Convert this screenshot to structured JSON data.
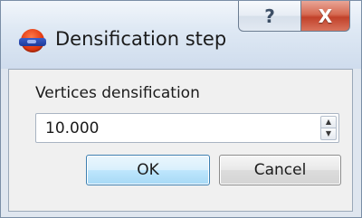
{
  "window": {
    "title": "Densification step",
    "help_label": "?",
    "close_label": "X"
  },
  "form": {
    "field_label": "Vertices densification",
    "field_value": "10.000",
    "spin_up": "▲",
    "spin_down": "▼"
  },
  "buttons": {
    "ok_label": "OK",
    "cancel_label": "Cancel"
  },
  "icons": {
    "app": "app-globe-icon",
    "help": "help-icon",
    "close": "close-icon"
  }
}
